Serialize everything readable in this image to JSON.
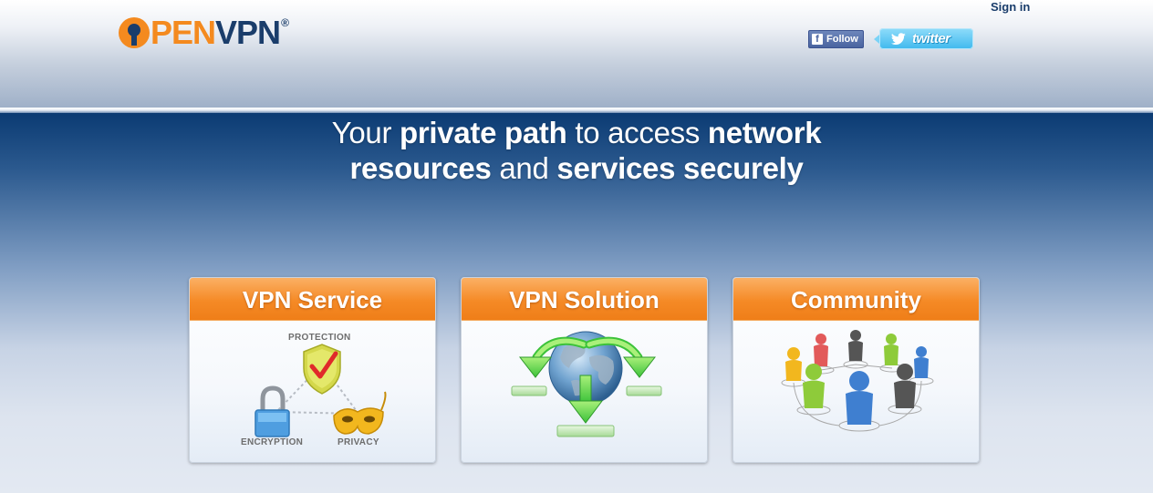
{
  "header": {
    "logo": {
      "pen": "PEN",
      "vpn": "VPN",
      "reg": "®"
    },
    "sign_in": "Sign in",
    "facebook_follow": "Follow",
    "twitter_label": "twitter"
  },
  "hero": {
    "line1": {
      "a": "Your ",
      "b": "private path",
      "c": " to access ",
      "d": "network"
    },
    "line2": {
      "a": "resources",
      "b": " and ",
      "c": "services securely"
    }
  },
  "cards": [
    {
      "title": "VPN Service",
      "labels": {
        "protection": "PROTECTION",
        "encryption": "ENCRYPTION",
        "privacy": "PRIVACY"
      }
    },
    {
      "title": "VPN Solution"
    },
    {
      "title": "Community"
    }
  ],
  "colors": {
    "brand_orange": "#f48a1f",
    "brand_navy": "#1a3d6b",
    "hero_dark_blue": "#0b3b73",
    "facebook_blue": "#4a64a0",
    "twitter_blue": "#3fb9ee"
  }
}
